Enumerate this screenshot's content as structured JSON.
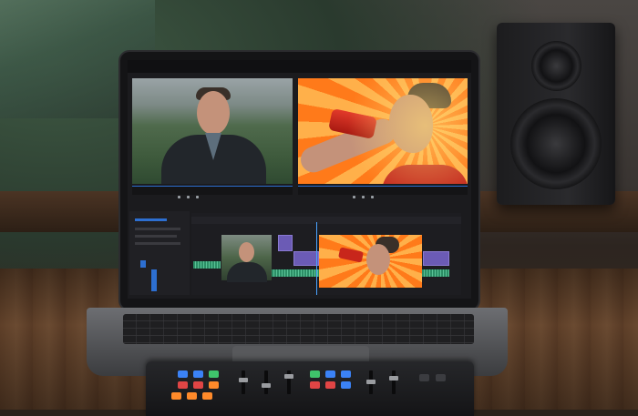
{
  "scene": {
    "source_monitor": {
      "label": "",
      "timecode": ""
    },
    "program_monitor": {
      "label": "",
      "timecode": ""
    }
  },
  "colors": {
    "accent": "#4aa3ff",
    "program_orange": "#ff7a1a",
    "program_yellow": "#ffb04a",
    "clip_purple": "#6b5bb5",
    "audio_green": "#2e9a6e",
    "pad_blue": "#3b82f6",
    "pad_red": "#e04545",
    "pad_green": "#3fc46b",
    "pad_orange": "#ff8a2a"
  },
  "icons": [
    "speaker-icon",
    "laptop-icon",
    "playhead-icon",
    "control-surface-icon"
  ]
}
